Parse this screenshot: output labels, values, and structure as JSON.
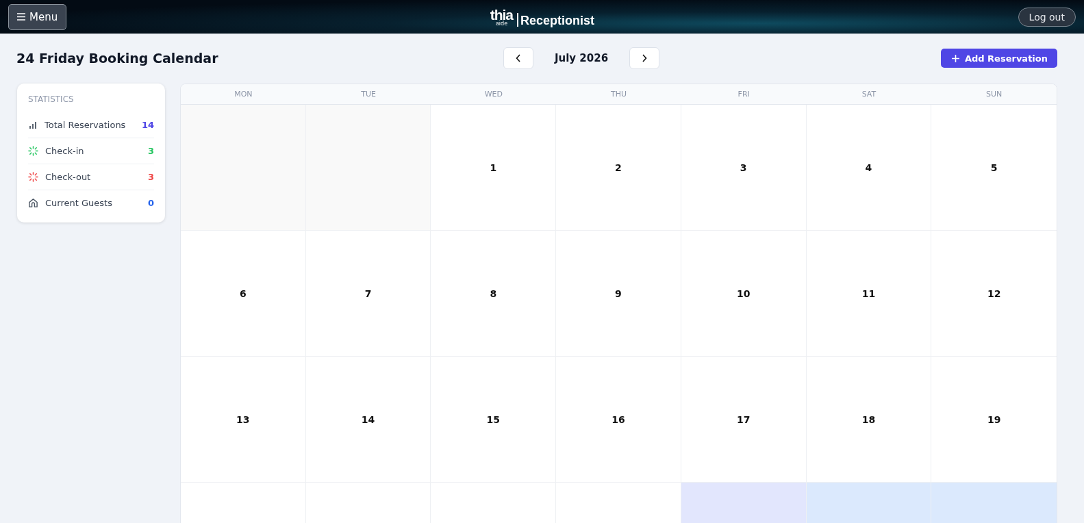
{
  "topbar": {
    "menu_button": "Menu",
    "logo": {
      "brand": "thia",
      "brand_sub": "aide",
      "product": "Receptionist"
    },
    "logout_button": "Log out"
  },
  "page": {
    "title": "24 Friday Booking Calendar",
    "month": "July 2026",
    "add_button": "Add Reservation"
  },
  "statistics": {
    "heading": "STATISTICS",
    "items": [
      {
        "kind": "chart",
        "label": "Total Reservations",
        "value": "14",
        "color": "#4f46e5"
      },
      {
        "kind": "checkin",
        "label": "Check-in",
        "value": "3",
        "color": "#22c55e"
      },
      {
        "kind": "checkout",
        "label": "Check-out",
        "value": "3",
        "color": "#ef4444"
      },
      {
        "kind": "home",
        "label": "Current Guests",
        "value": "0",
        "color": "#2563eb"
      }
    ]
  },
  "calendar": {
    "weekdays": [
      "MON",
      "TUE",
      "WED",
      "THU",
      "FRI",
      "SAT",
      "SUN"
    ],
    "weeks": [
      [
        {
          "kind": "outside"
        },
        {
          "kind": "outside"
        },
        {
          "kind": "day",
          "day": "1"
        },
        {
          "kind": "day",
          "day": "2"
        },
        {
          "kind": "day",
          "day": "3"
        },
        {
          "kind": "day",
          "day": "4"
        },
        {
          "kind": "day",
          "day": "5"
        }
      ],
      [
        {
          "kind": "day",
          "day": "6"
        },
        {
          "kind": "day",
          "day": "7"
        },
        {
          "kind": "day",
          "day": "8"
        },
        {
          "kind": "day",
          "day": "9"
        },
        {
          "kind": "day",
          "day": "10"
        },
        {
          "kind": "day",
          "day": "11"
        },
        {
          "kind": "day",
          "day": "12"
        }
      ],
      [
        {
          "kind": "day",
          "day": "13"
        },
        {
          "kind": "day",
          "day": "14"
        },
        {
          "kind": "day",
          "day": "15"
        },
        {
          "kind": "day",
          "day": "16"
        },
        {
          "kind": "day",
          "day": "17"
        },
        {
          "kind": "day",
          "day": "18"
        },
        {
          "kind": "day",
          "day": "19"
        }
      ],
      [
        {
          "kind": "blank"
        },
        {
          "kind": "blank"
        },
        {
          "kind": "blank"
        },
        {
          "kind": "blank"
        },
        {
          "kind": "today"
        },
        {
          "kind": "weekend"
        },
        {
          "kind": "weekend"
        }
      ]
    ]
  }
}
